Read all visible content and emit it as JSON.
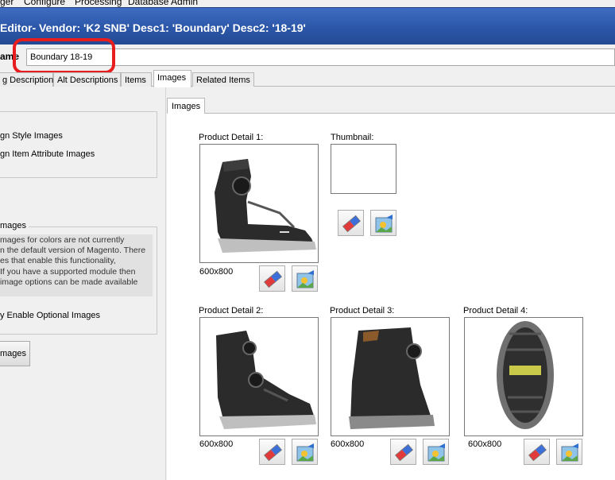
{
  "menu": [
    "ger",
    "Configure",
    "Processing",
    "Database Admin"
  ],
  "window": {
    "title": "Editor- Vendor: 'K2 SNB' Desc1: 'Boundary' Desc2: '18-19'"
  },
  "name_field": {
    "label": "ame",
    "value": "Boundary 18-19"
  },
  "tabs": [
    "g Description",
    "Alt Descriptions",
    "Items",
    "Images",
    "Related Items"
  ],
  "active_tab": "Images",
  "left": {
    "options": [
      "gn Style Images",
      "gn Item Attribute Images"
    ],
    "group_title": "mages",
    "notice_lines": [
      "mages for colors are not currently",
      "n the default version of Magento. There",
      "es that enable this functionality,",
      "If you have a supported module then",
      " image options can be made available"
    ],
    "optional_label": "y Enable Optional Images",
    "button_label": "mages"
  },
  "inner_tab": "Images",
  "slots": {
    "product_detail_1": {
      "label": "Product Detail 1:",
      "size": "600x800"
    },
    "thumbnail": {
      "label": "Thumbnail:"
    },
    "product_detail_2": {
      "label": "Product Detail 2:",
      "size": "600x800"
    },
    "product_detail_3": {
      "label": "Product Detail 3:",
      "size": "600x800"
    },
    "product_detail_4": {
      "label": "Product Detail 4:",
      "size": "600x800"
    }
  },
  "colors": {
    "title_bar": "#2c57a8",
    "highlight": "#e81e1e",
    "panel_bg": "#f0f0f0"
  },
  "icons": {
    "clear": "eraser-icon",
    "load": "image-picture-icon"
  }
}
